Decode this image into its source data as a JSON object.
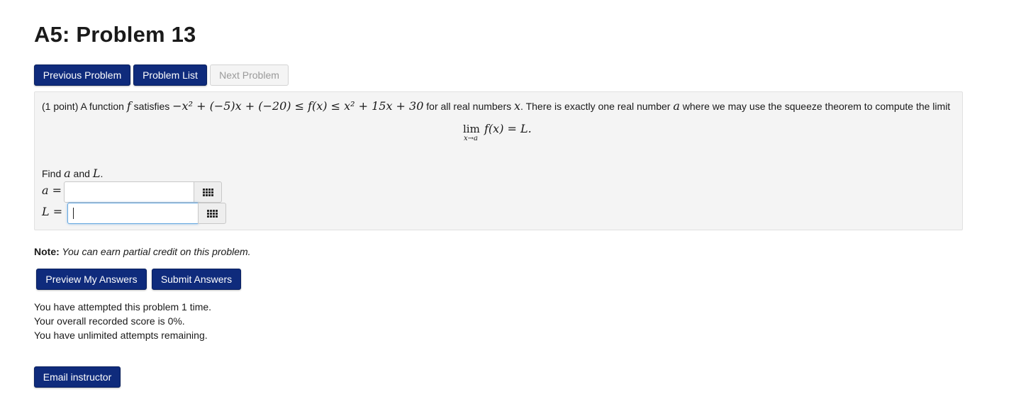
{
  "page": {
    "title": "A5: Problem 13"
  },
  "nav": {
    "previous": "Previous Problem",
    "list": "Problem List",
    "next": "Next Problem"
  },
  "problem": {
    "points": "(1 point) A function ",
    "f": "f",
    "satisfies": " satisfies ",
    "inequality_left": "−x² + (−5)x + (−20) ≤ f(x) ≤ x² + 15x + 30",
    "for_all": " for all real numbers ",
    "x": "x",
    "exactly_one": ". There is exactly one real number ",
    "a": "a",
    "squeeze_text": " where we may use the squeeze theorem to compute the limit",
    "limit_word": "lim",
    "limit_sub": "x→a",
    "limit_expr": "f(x) = L.",
    "find_prefix": "Find ",
    "find_a": "a",
    "find_and": " and ",
    "find_L": "L",
    "find_end": ".",
    "label_a": "a =",
    "label_L": "L =",
    "input_a_value": "",
    "input_L_value": ""
  },
  "note": {
    "label": "Note:",
    "text": " You can earn partial credit on this problem."
  },
  "actions": {
    "preview": "Preview My Answers",
    "submit": "Submit Answers"
  },
  "status": {
    "attempts": "You have attempted this problem 1 time.",
    "score": "Your overall recorded score is 0%.",
    "remaining": "You have unlimited attempts remaining."
  },
  "footer": {
    "email": "Email instructor"
  }
}
